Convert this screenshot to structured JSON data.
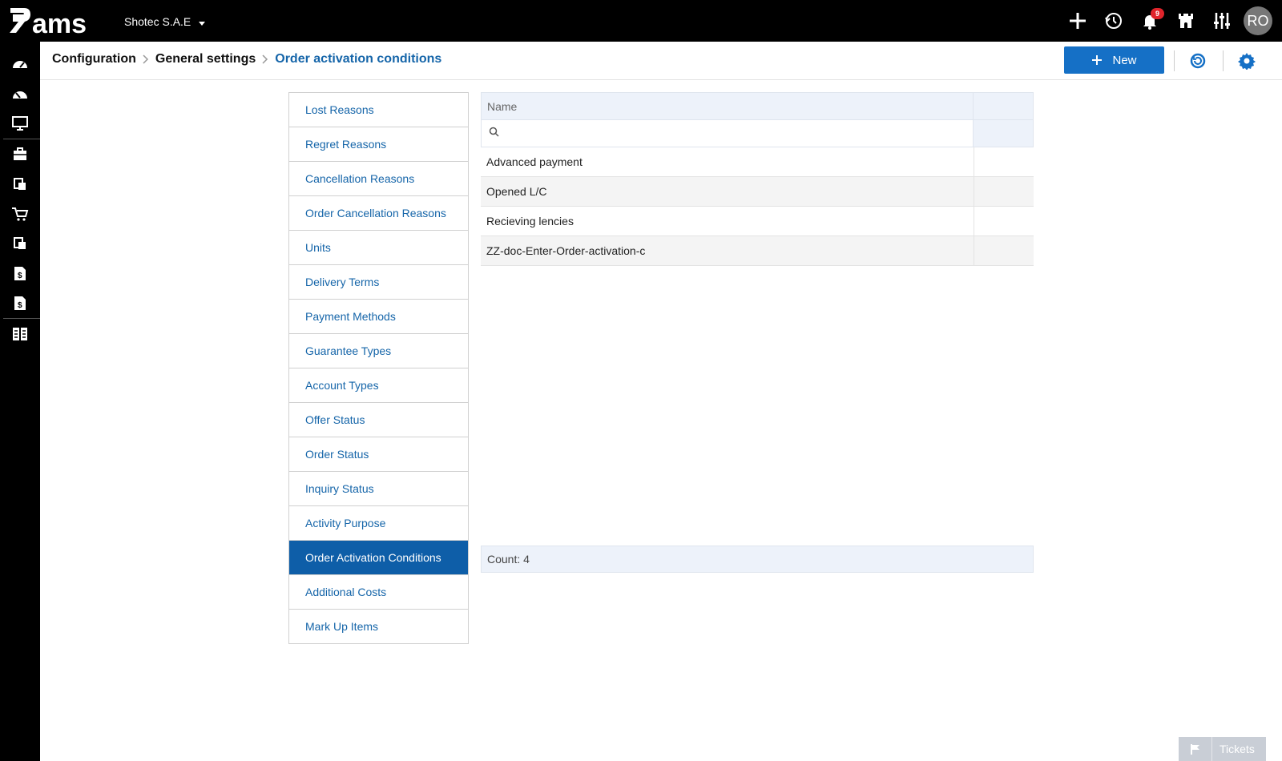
{
  "topbar": {
    "logo_alt": "ams",
    "company": "Shotec S.A.E",
    "notification_count": "9",
    "avatar_initials": "RO",
    "icons": [
      "plus-icon",
      "history-icon",
      "bell-icon",
      "castle-icon",
      "sliders-icon"
    ]
  },
  "leftrail": {
    "icons": [
      "dashboard-icon",
      "dashboard-icon",
      "monitor-icon",
      "briefcase-icon",
      "documents-icon",
      "cart-icon",
      "documents-icon",
      "invoice-icon",
      "invoice-icon",
      "grid-icon"
    ]
  },
  "breadcrumb": {
    "items": [
      "Configuration",
      "General settings"
    ],
    "current": "Order activation conditions"
  },
  "toolbar": {
    "new_label": "New",
    "refresh_icon": "refresh-icon",
    "settings_icon": "gear-icon"
  },
  "menu": {
    "items": [
      {
        "label": "Lost Reasons"
      },
      {
        "label": "Regret Reasons"
      },
      {
        "label": "Cancellation Reasons"
      },
      {
        "label": "Order Cancellation Reasons"
      },
      {
        "label": "Units"
      },
      {
        "label": "Delivery Terms"
      },
      {
        "label": "Payment Methods"
      },
      {
        "label": "Guarantee Types"
      },
      {
        "label": "Account Types"
      },
      {
        "label": "Offer Status"
      },
      {
        "label": "Order Status"
      },
      {
        "label": "Inquiry Status"
      },
      {
        "label": "Activity Purpose"
      },
      {
        "label": "Order Activation Conditions"
      },
      {
        "label": "Additional Costs"
      },
      {
        "label": "Mark Up Items"
      }
    ],
    "active_index": 13
  },
  "grid": {
    "column_name": "Name",
    "filter_value": "",
    "rows": [
      {
        "name": "Advanced payment"
      },
      {
        "name": "Opened L/C"
      },
      {
        "name": "Recieving lencies"
      },
      {
        "name": "ZZ-doc-Enter-Order-activation-c"
      }
    ],
    "footer": "Count: 4"
  },
  "tickets": {
    "label": "Tickets"
  },
  "colors": {
    "accent": "#1570c6",
    "active_menu": "#0e5ea8",
    "link": "#1565a9",
    "badge": "#e0242b"
  }
}
